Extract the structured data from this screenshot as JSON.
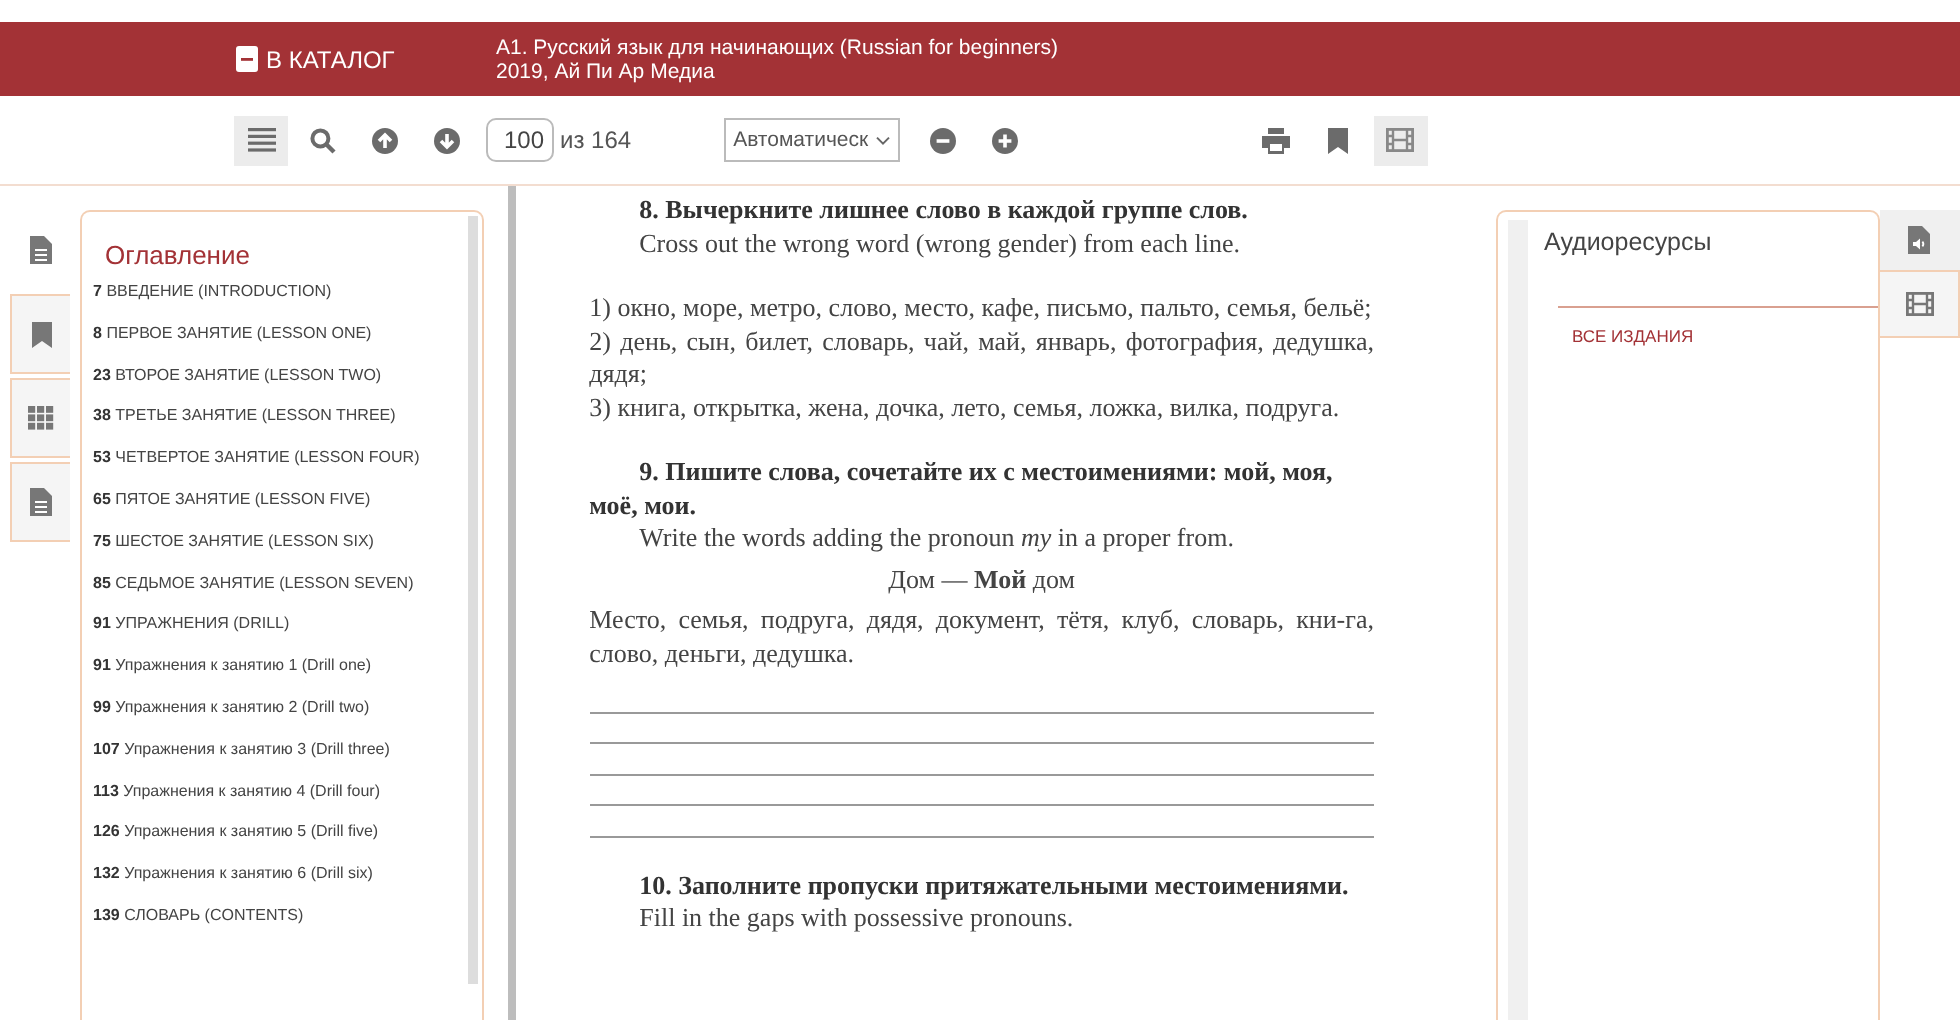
{
  "header": {
    "catalog_button": "В КАТАЛОГ",
    "book_title": "А1. Русский язык для начинающих (Russian for beginners)",
    "book_meta": "2019, Ай Пи Ар Медиа"
  },
  "toolbar": {
    "tools": [
      {
        "kind": "toc",
        "selected": true
      },
      {
        "kind": "search",
        "selected": false
      },
      {
        "kind": "up",
        "selected": false
      },
      {
        "kind": "down",
        "selected": false
      }
    ],
    "page_input": "100",
    "page_total": "из 164",
    "zoom": "Автоматическ",
    "right_tools": [
      {
        "kind": "print",
        "selected": false
      },
      {
        "kind": "bookmark",
        "selected": false
      },
      {
        "kind": "film",
        "selected": true
      }
    ]
  },
  "left_tabs": [
    {
      "kind": "document",
      "selected": true
    },
    {
      "kind": "bookmark",
      "selected": false
    },
    {
      "kind": "grid",
      "selected": false
    },
    {
      "kind": "document",
      "selected": false
    }
  ],
  "toc": {
    "title": "Оглавление",
    "items": [
      {
        "page": "7",
        "title": "ВВЕДЕНИЕ (INTRODUCTION)"
      },
      {
        "page": "8",
        "title": "ПЕРВОЕ ЗАНЯТИЕ (LESSON ONE)"
      },
      {
        "page": "23",
        "title": "ВТОРОЕ ЗАНЯТИЕ (LESSON TWO)"
      },
      {
        "page": "38",
        "title": "ТРЕТЬЕ ЗАНЯТИЕ (LESSON THREE)"
      },
      {
        "page": "53",
        "title": "ЧЕТВЕРТОЕ ЗАНЯТИЕ (LESSON FOUR)"
      },
      {
        "page": "65",
        "title": "ПЯТОЕ ЗАНЯТИЕ (LESSON FIVE)"
      },
      {
        "page": "75",
        "title": "ШЕСТОЕ ЗАНЯТИЕ (LESSON SIX)"
      },
      {
        "page": "85",
        "title": "СЕДЬМОЕ ЗАНЯТИЕ (LESSON SEVEN)"
      },
      {
        "page": "91",
        "title": "УПРАЖНЕНИЯ (DRILL)"
      },
      {
        "page": "91",
        "title": "Упражнения к занятию 1 (Drill one)"
      },
      {
        "page": "99",
        "title": "Упражнения к занятию 2 (Drill two)"
      },
      {
        "page": "107",
        "title": "Упражнения к занятию 3 (Drill three)"
      },
      {
        "page": "113",
        "title": "Упражнения к занятию 4 (Drill four)"
      },
      {
        "page": "126",
        "title": "Упражнения к занятию 5 (Drill five)"
      },
      {
        "page": "132",
        "title": "Упражнения к занятию 6 (Drill six)"
      },
      {
        "page": "139",
        "title": "СЛОВАРЬ (CONTENTS)"
      }
    ]
  },
  "page": [
    {
      "kind": "heading",
      "text": "8. Вычеркните лишнее слово в каждой группе слов."
    },
    {
      "kind": "indent",
      "text": "Cross out the wrong word (wrong gender) from each line."
    },
    {
      "kind": "gap"
    },
    {
      "kind": "para",
      "text": "1) окно, море, метро, слово, место, кафе, письмо, пальто, семья, бельё;"
    },
    {
      "kind": "para",
      "text": "2) день, сын, билет, словарь, чай, май, январь, фотография, дедушка, дядя;"
    },
    {
      "kind": "para",
      "text": "3) книга, открытка, жена, дочка, лето, семья, ложка, вилка, подруга."
    },
    {
      "kind": "gap"
    },
    {
      "kind": "heading",
      "text": "9. Пишите слова, сочетайте их с местоимениями: мой, моя, моё, мои."
    },
    {
      "kind": "indent",
      "text": "Write the words adding the pronoun *my* in a proper from."
    },
    {
      "kind": "example",
      "text": "Дом — **Мой** дом"
    },
    {
      "kind": "para",
      "text": "Место, семья, подруга, дядя, документ, тётя, клуб, словарь, кни-га, слово, деньги, дедушка."
    },
    {
      "kind": "lines"
    },
    {
      "kind": "gap"
    },
    {
      "kind": "heading",
      "text": "10. Заполните пропуски притяжательными местоимениями."
    },
    {
      "kind": "indent",
      "text": "Fill in the gaps with possessive pronouns."
    }
  ],
  "right_panel": {
    "title": "Аудиоресурсы",
    "link": "ВСЕ ИЗДАНИЯ"
  },
  "right_tabs": [
    {
      "kind": "audio",
      "selected": true
    },
    {
      "kind": "film",
      "selected": false
    }
  ]
}
